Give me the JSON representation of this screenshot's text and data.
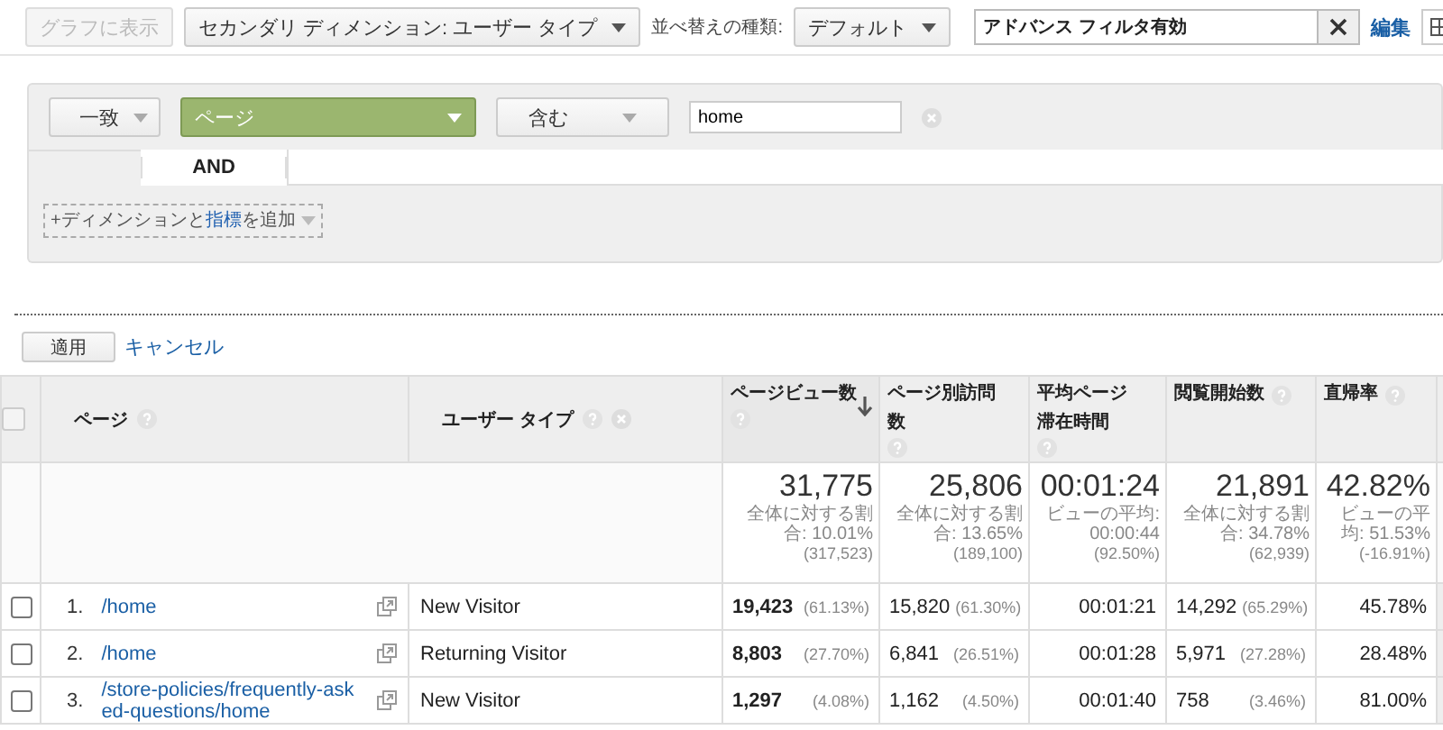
{
  "toolbar": {
    "chart_button": {
      "label": "グラフに表示",
      "disabled": true
    },
    "secondary_dimension": "セカンダリ ディメンション: ユーザー タイプ",
    "sort_label": "並べ替えの種類:",
    "sort_value": "デフォルト",
    "filter_status": "アドバンス フィルタ有効",
    "edit_link": "編集"
  },
  "filter": {
    "match": "一致",
    "dimension": "ページ",
    "operator": "含む",
    "value": "home",
    "conjunction": "AND",
    "add": {
      "before": "+ディメンションと",
      "link": "指標",
      "after": "を追加"
    }
  },
  "actions": {
    "apply": "適用",
    "cancel": "キャンセル"
  },
  "table": {
    "header_checkbox": {
      "checked": false
    },
    "columns": [
      {
        "label": "ページ",
        "kind": "dimension",
        "sorted": false,
        "removable": false
      },
      {
        "label": "ユーザー タイプ",
        "kind": "dimension",
        "sorted": false,
        "removable": true
      },
      {
        "label": "ページビュー数",
        "kind": "metric",
        "sorted": true
      },
      {
        "label": "ページ別訪問数",
        "kind": "metric",
        "sorted": false
      },
      {
        "label": "平均ページ滞在時間",
        "kind": "metric",
        "sorted": false
      },
      {
        "label": "閲覧開始数",
        "kind": "metric",
        "sorted": false
      },
      {
        "label": "直帰率",
        "kind": "metric",
        "sorted": false
      }
    ],
    "summary": [
      {
        "value": "31,775",
        "note": "全体に対する割合: 10.01%",
        "total": "(317,523)"
      },
      {
        "value": "25,806",
        "note": "全体に対する割合: 13.65%",
        "total": "(189,100)"
      },
      {
        "value": "00:01:24",
        "note": "ビューの平均: 00:00:44",
        "total": "(92.50%)"
      },
      {
        "value": "21,891",
        "note": "全体に対する割合: 34.78%",
        "total": "(62,939)"
      },
      {
        "value": "42.82%",
        "note": "ビューの平均: 51.53%",
        "total": "(-16.91%)"
      }
    ],
    "rows": [
      {
        "checked": false,
        "index": "1.",
        "page": "/home",
        "user_type": "New Visitor",
        "metrics": [
          {
            "value": "19,423",
            "pct": "(61.13%)"
          },
          {
            "value": "15,820",
            "pct": "(61.30%)"
          },
          {
            "value": "00:01:21"
          },
          {
            "value": "14,292",
            "pct": "(65.29%)"
          },
          {
            "value": "45.78%"
          }
        ]
      },
      {
        "checked": false,
        "index": "2.",
        "page": "/home",
        "user_type": "Returning Visitor",
        "metrics": [
          {
            "value": "8,803",
            "pct": "(27.70%)"
          },
          {
            "value": "6,841",
            "pct": "(26.51%)"
          },
          {
            "value": "00:01:28"
          },
          {
            "value": "5,971",
            "pct": "(27.28%)"
          },
          {
            "value": "28.48%"
          }
        ]
      },
      {
        "checked": false,
        "index": "3.",
        "page": "/store-policies/frequently-asked-questions/home",
        "user_type": "New Visitor",
        "metrics": [
          {
            "value": "1,297",
            "pct": "(4.08%)"
          },
          {
            "value": "1,162",
            "pct": "(4.50%)"
          },
          {
            "value": "00:01:40"
          },
          {
            "value": "758",
            "pct": "(3.46%)"
          },
          {
            "value": "81.00%"
          }
        ]
      }
    ]
  }
}
